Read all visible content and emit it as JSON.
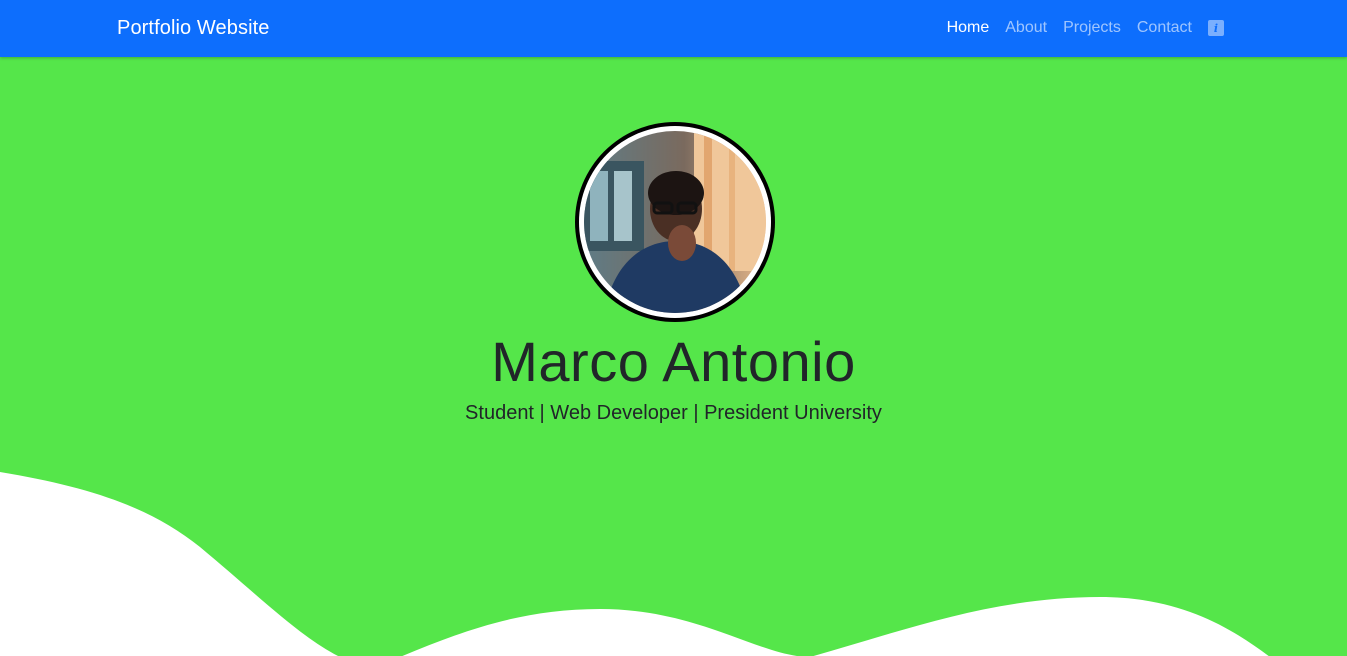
{
  "navbar": {
    "brand": "Portfolio Website",
    "links": [
      {
        "label": "Home",
        "active": true
      },
      {
        "label": "About",
        "active": false
      },
      {
        "label": "Projects",
        "active": false
      },
      {
        "label": "Contact",
        "active": false
      }
    ],
    "icon": "info-icon"
  },
  "hero": {
    "name": "Marco Antonio",
    "tagline": "Student | Web Developer | President University",
    "avatar_icon": "profile-photo"
  },
  "colors": {
    "navbar": "#0d6efd",
    "hero_background": "#55e64a",
    "wave": "#ffffff",
    "text": "#212529"
  }
}
